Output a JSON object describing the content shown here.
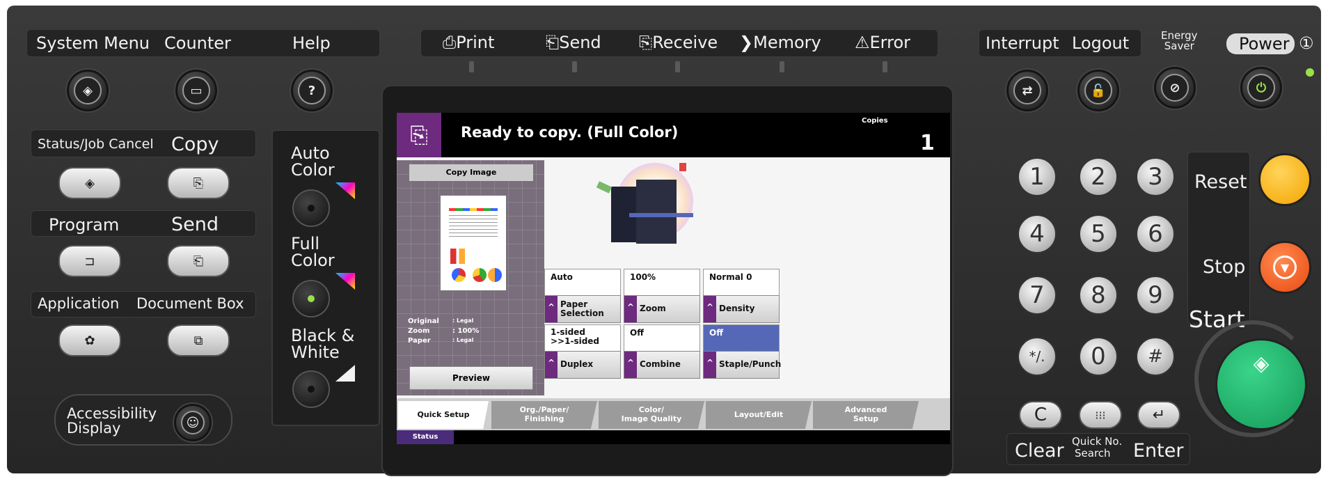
{
  "top_left": {
    "system_menu": "System Menu",
    "counter": "Counter",
    "help": "Help",
    "help_glyph": "?"
  },
  "indicators": [
    {
      "label": "Print",
      "glyph": "⎙"
    },
    {
      "label": "Send",
      "glyph": "⎗"
    },
    {
      "label": "Receive",
      "glyph": "⎘"
    },
    {
      "label": "Memory",
      "glyph": "❯"
    },
    {
      "label": "Error",
      "glyph": "⚠"
    }
  ],
  "top_right": {
    "interrupt": "Interrupt",
    "logout": "Logout",
    "energy_saver_line1": "Energy",
    "energy_saver_line2": "Saver",
    "power": "Power",
    "power_symbol": "①"
  },
  "left_keys": {
    "status_job_cancel": "Status/Job Cancel",
    "copy": "Copy",
    "program": "Program",
    "send": "Send",
    "application": "Application",
    "document_box": "Document Box",
    "accessibility_line1": "Accessibility",
    "accessibility_line2": "Display"
  },
  "color_modes": [
    {
      "line1": "Auto",
      "line2": "Color"
    },
    {
      "line1": "Full",
      "line2": "Color"
    },
    {
      "line1": "Black &",
      "line2": "White"
    }
  ],
  "screen": {
    "status_title": "Ready to copy. (Full Color)",
    "copies_label": "Copies",
    "copies_value": "1",
    "copy_image_label": "Copy Image",
    "info": {
      "original_label": "Original",
      "original_value": ": Legal",
      "zoom_label": "Zoom",
      "zoom_value": ": 100%",
      "paper_label": "Paper",
      "paper_value": ": Legal"
    },
    "preview_label": "Preview",
    "settings": [
      {
        "value": "Auto",
        "button_line1": "Paper",
        "button_line2": "Selection"
      },
      {
        "value": "100%",
        "button_line1": "Zoom",
        "button_line2": ""
      },
      {
        "value": "Normal 0",
        "button_line1": "Density",
        "button_line2": ""
      },
      {
        "value_line1": "1-sided",
        "value_line2": ">>1-sided",
        "button_line1": "Duplex",
        "button_line2": ""
      },
      {
        "value": "Off",
        "button_line1": "Combine",
        "button_line2": ""
      },
      {
        "value": "Off",
        "button_line1": "Staple/Punch",
        "button_line2": ""
      }
    ],
    "tabs": [
      {
        "line1": "Quick Setup",
        "line2": ""
      },
      {
        "line1": "Org./Paper/",
        "line2": "Finishing"
      },
      {
        "line1": "Color/",
        "line2": "Image Quality"
      },
      {
        "line1": "Layout/Edit",
        "line2": ""
      },
      {
        "line1": "Advanced",
        "line2": "Setup"
      }
    ],
    "status_tab": "Status"
  },
  "keypad": {
    "digits": [
      "1",
      "2",
      "3",
      "4",
      "5",
      "6",
      "7",
      "8",
      "9",
      "*/.",
      "0",
      "#"
    ],
    "reset": "Reset",
    "stop": "Stop",
    "start": "Start",
    "clear": "Clear",
    "quick_no_line1": "Quick No.",
    "quick_no_line2": "Search",
    "enter": "Enter",
    "clear_glyph": "C",
    "quick_glyph": "⁝⁝⁝",
    "enter_glyph": "↵"
  },
  "colors": {
    "accent_purple": "#6d2a7e",
    "start_green": "#1fb56a",
    "stop_orange": "#ff5a1a",
    "reset_yellow": "#ffb31a",
    "selected_blue": "#5568b8",
    "power_led": "#9be04a"
  }
}
